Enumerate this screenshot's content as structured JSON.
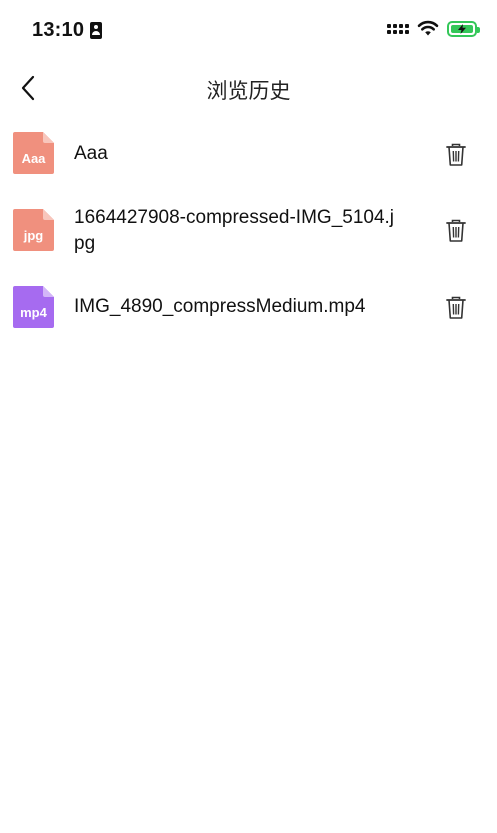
{
  "status_bar": {
    "time": "13:10"
  },
  "nav": {
    "title": "浏览历史"
  },
  "files": [
    {
      "name": "Aaa",
      "ext": "Aaa",
      "color": "#F0907E",
      "icon": "text-file-icon"
    },
    {
      "name": "1664427908-compressed-IMG_5104.jpg",
      "ext": "jpg",
      "color": "#F0907E",
      "icon": "image-file-icon"
    },
    {
      "name": "IMG_4890_compressMedium.mp4",
      "ext": "mp4",
      "color": "#A66BF0",
      "icon": "video-file-icon"
    }
  ],
  "colors": {
    "battery": "#34c759",
    "text": "#111111",
    "background": "#ffffff"
  }
}
